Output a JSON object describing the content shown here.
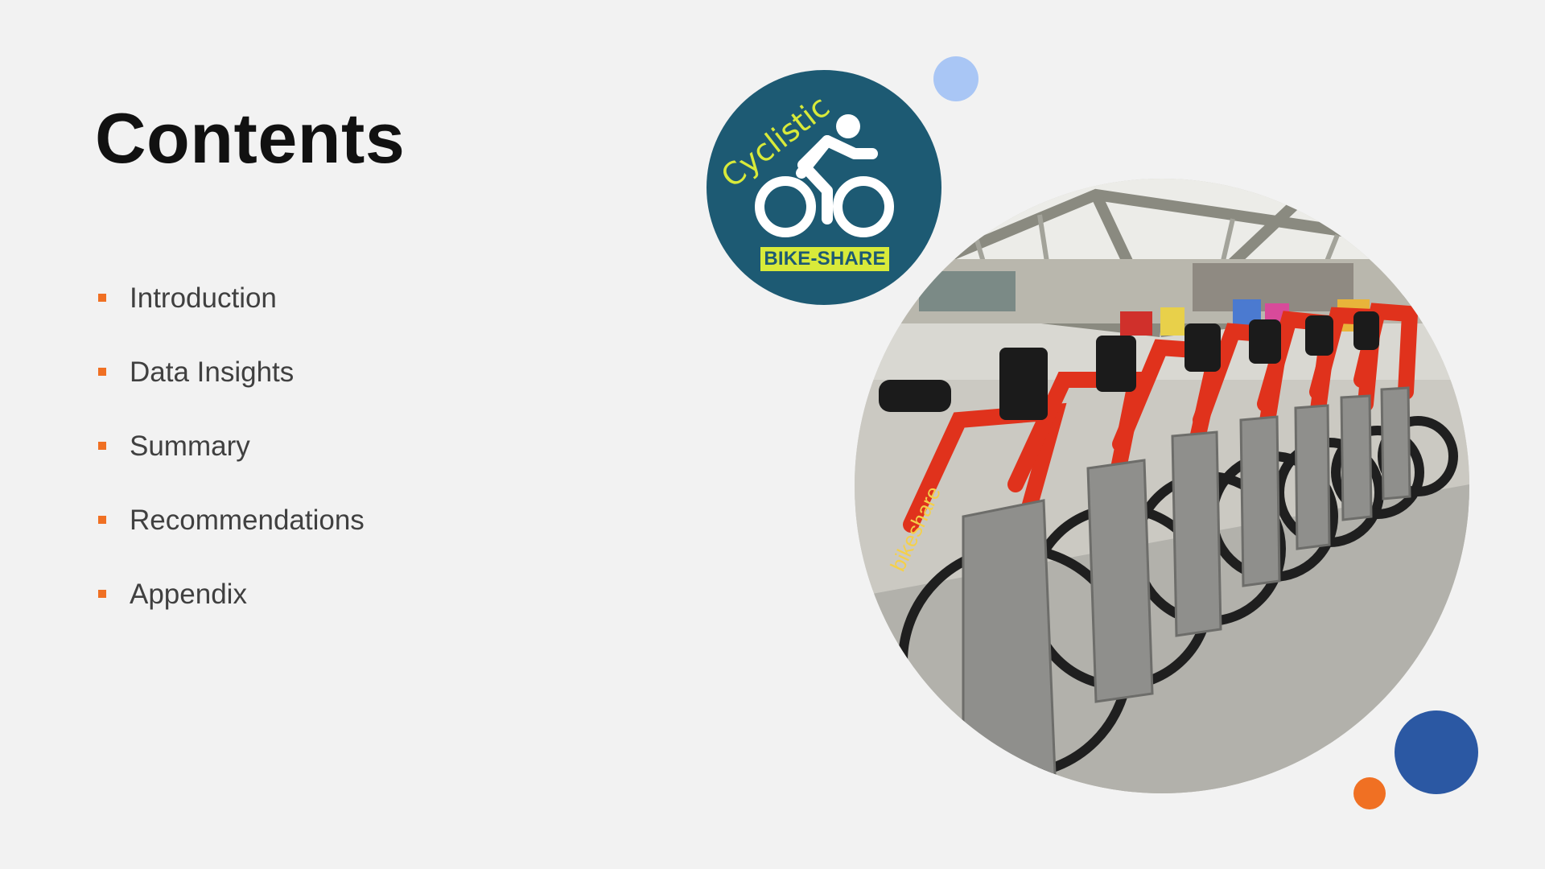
{
  "slide": {
    "title": "Contents",
    "items": [
      {
        "label": "Introduction"
      },
      {
        "label": "Data Insights"
      },
      {
        "label": "Summary"
      },
      {
        "label": "Recommendations"
      },
      {
        "label": "Appendix"
      }
    ]
  },
  "logo": {
    "wordmark": "Cyclistic",
    "badge": "BIKE-SHARE",
    "icon": "cyclist-icon"
  },
  "photo": {
    "subject": "bike-share-station-photo",
    "bike_text": "bikeshare"
  },
  "colors": {
    "background": "#f2f2f2",
    "bullet": "#f07023",
    "logo_bg": "#1d5a73",
    "logo_accent": "#d8ea3a",
    "light_blue": "#a9c6f5",
    "dark_blue": "#2b58a3",
    "orange": "#f07023"
  }
}
